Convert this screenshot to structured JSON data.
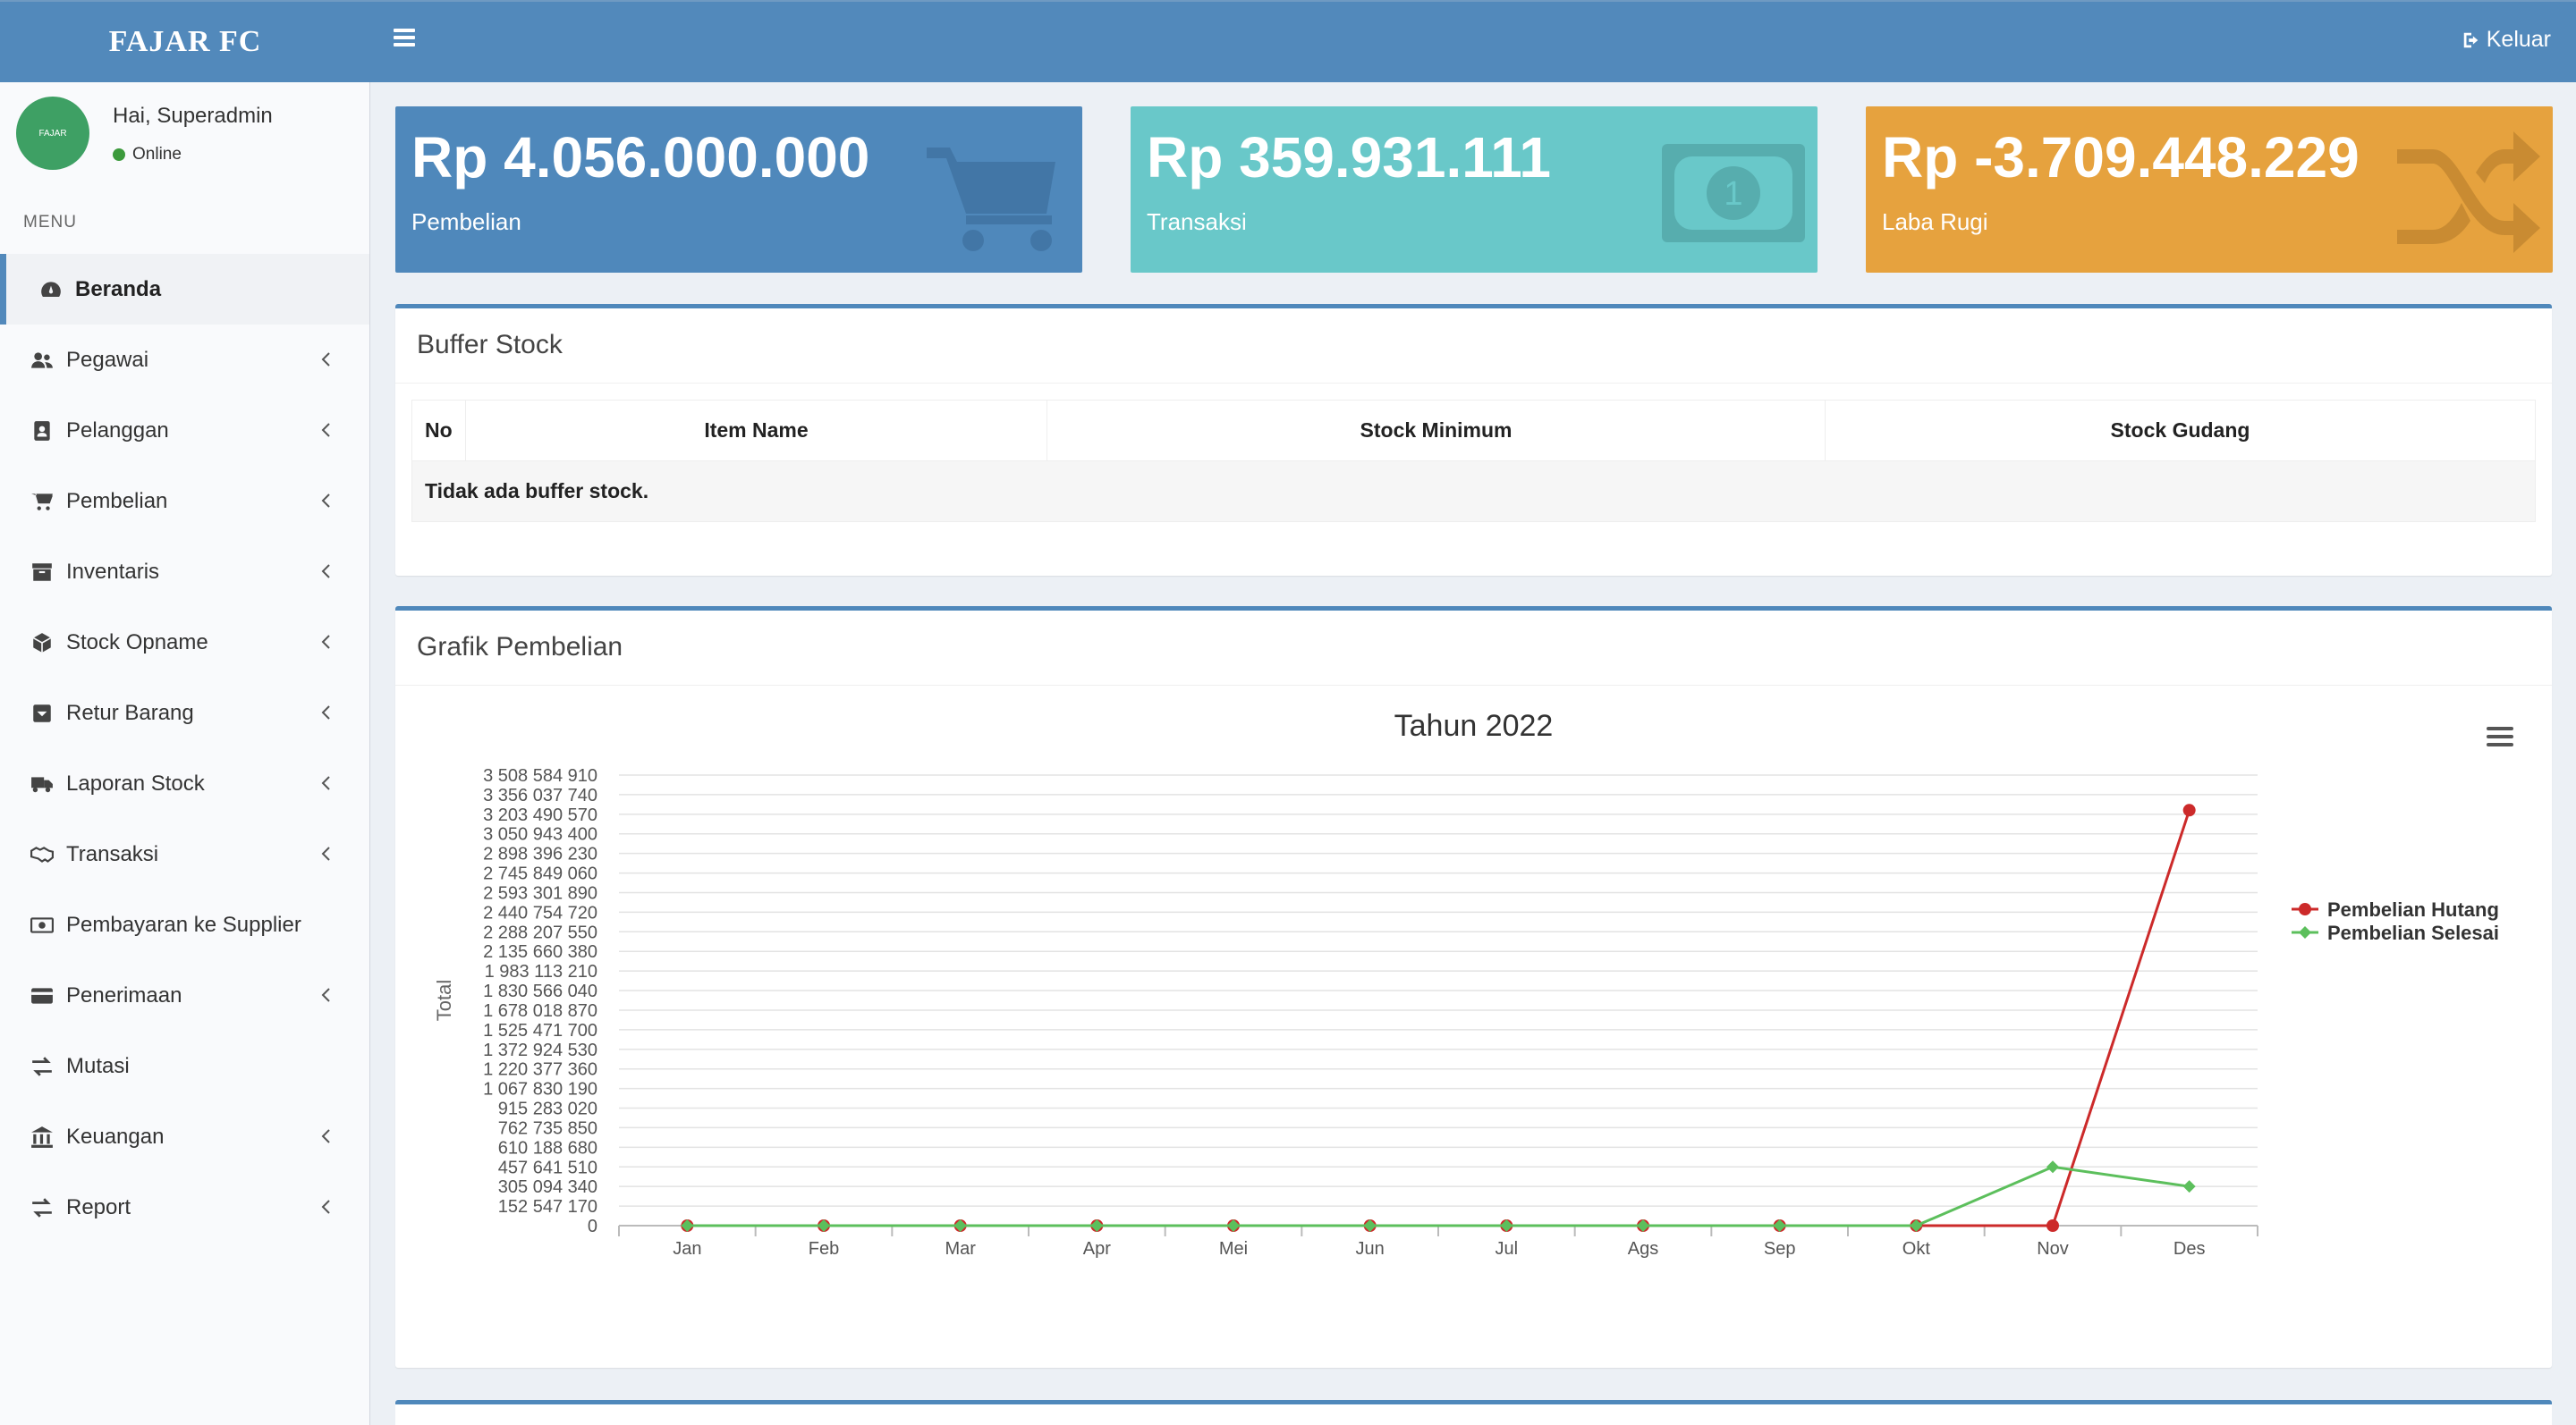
{
  "header": {
    "brand": "FAJAR FC",
    "logout_label": "Keluar"
  },
  "user": {
    "avatar_text": "FAJAR",
    "greeting": "Hai, Superadmin",
    "status": "Online"
  },
  "sidebar": {
    "menu_header": "MENU",
    "items": [
      {
        "label": "Beranda",
        "icon": "dashboard-icon",
        "active": true,
        "has_chevron": false
      },
      {
        "label": "Pegawai",
        "icon": "users-icon",
        "has_chevron": true
      },
      {
        "label": "Pelanggan",
        "icon": "contact-book-icon",
        "has_chevron": true
      },
      {
        "label": "Pembelian",
        "icon": "cart-icon",
        "has_chevron": true
      },
      {
        "label": "Inventaris",
        "icon": "archive-icon",
        "has_chevron": true
      },
      {
        "label": "Stock Opname",
        "icon": "cube-icon",
        "has_chevron": true
      },
      {
        "label": "Retur Barang",
        "icon": "return-box-icon",
        "has_chevron": true
      },
      {
        "label": "Laporan Stock",
        "icon": "truck-icon",
        "has_chevron": true
      },
      {
        "label": "Transaksi",
        "icon": "handshake-icon",
        "has_chevron": true
      },
      {
        "label": "Pembayaran ke Supplier",
        "icon": "money-icon",
        "has_chevron": false
      },
      {
        "label": "Penerimaan",
        "icon": "credit-card-icon",
        "has_chevron": true
      },
      {
        "label": "Mutasi",
        "icon": "exchange-icon",
        "has_chevron": false
      },
      {
        "label": "Keuangan",
        "icon": "bank-icon",
        "has_chevron": true
      },
      {
        "label": "Report",
        "icon": "exchange-icon",
        "has_chevron": true
      }
    ]
  },
  "info_boxes": [
    {
      "amount": "Rp 4.056.000.000",
      "caption": "Pembelian",
      "icon": "cart-icon",
      "color": "#4f88bb"
    },
    {
      "amount": "Rp 359.931.111",
      "caption": "Transaksi",
      "icon": "money-icon",
      "color": "#69c8c9"
    },
    {
      "amount": "Rp -3.709.448.229",
      "caption": "Laba Rugi",
      "icon": "shuffle-icon",
      "color": "#e6a23e"
    }
  ],
  "buffer_stock": {
    "title": "Buffer Stock",
    "columns": [
      "No",
      "Item Name",
      "Stock Minimum",
      "Stock Gudang"
    ],
    "empty_message": "Tidak ada buffer stock."
  },
  "grafik": {
    "title": "Grafik Pembelian"
  },
  "chart_data": {
    "type": "line",
    "title": "Tahun 2022",
    "xlabel": "",
    "ylabel": "Total",
    "categories": [
      "Jan",
      "Feb",
      "Mar",
      "Apr",
      "Mei",
      "Jun",
      "Jul",
      "Ags",
      "Sep",
      "Okt",
      "Nov",
      "Des"
    ],
    "y_ticks": [
      "0",
      "152 547 170",
      "305 094 340",
      "457 641 510",
      "610 188 680",
      "762 735 850",
      "915 283 020",
      "1 067 830 190",
      "1 220 377 360",
      "1 372 924 530",
      "1 525 471 700",
      "1 678 018 870",
      "1 830 566 040",
      "1 983 113 210",
      "2 135 660 380",
      "2 288 207 550",
      "2 440 754 720",
      "2 593 301 890",
      "2 745 849 060",
      "2 898 396 230",
      "3 050 943 400",
      "3 203 490 570",
      "3 356 037 740",
      "3 508 584 910"
    ],
    "ylim": [
      0,
      3508584910
    ],
    "grid": true,
    "legend_position": "right",
    "series": [
      {
        "name": "Pembelian Hutang",
        "color": "#cc2a2a",
        "marker": "circle",
        "values": [
          0,
          0,
          0,
          0,
          0,
          0,
          0,
          0,
          0,
          0,
          0,
          3235000000
        ]
      },
      {
        "name": "Pembelian Selesai",
        "color": "#5cbf5c",
        "marker": "diamond",
        "values": [
          0,
          0,
          0,
          0,
          0,
          0,
          0,
          0,
          0,
          0,
          457641510,
          305094340
        ]
      }
    ]
  }
}
